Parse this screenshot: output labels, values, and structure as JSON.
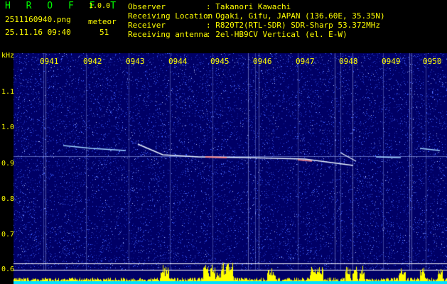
{
  "header": {
    "app_logo": "H R O F F T",
    "version": "1.0.0",
    "filename": "2511160940.png",
    "timestamp": "25.11.16 09:40",
    "meteor_label": "meteor",
    "meteor_count": "51",
    "observer": {
      "label": "Observer",
      "value": ": Takanori Kawachi"
    },
    "location": {
      "label": "Receiving Location",
      "value": ": Ogaki, Gifu, JAPAN (136.60E, 35.35N)"
    },
    "receiver": {
      "label": "Receiver",
      "value": ": R820T2(RTL-SDR) SDR-Sharp 53.372MHz"
    },
    "antenna": {
      "label": "Receiving antenna",
      "value": ": 2el-HB9CV Vertical (el. E-W)"
    }
  },
  "spectrogram": {
    "unit_label": "kHz",
    "y_ticks": [
      "1.1",
      "1.0",
      "0.9",
      "0.8",
      "0.7",
      "0.6"
    ],
    "time_labels": [
      "0941",
      "0942",
      "0943",
      "0944",
      "0945",
      "0946",
      "0947",
      "0948",
      "0949",
      "0950"
    ],
    "colors": {
      "background": "#000066",
      "noise": "#3a5cff",
      "signal": "#ffffff",
      "label": "#ffff00",
      "meter": "#ffff00",
      "meter_base": "#00e0ff"
    }
  }
}
